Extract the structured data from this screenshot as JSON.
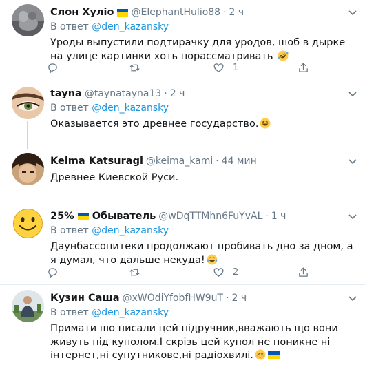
{
  "tweets": [
    {
      "name": "Слон Хуліо",
      "handle": "@ElephantHulio88",
      "time": "2 ч",
      "reply_prefix": "В ответ",
      "reply_to": "@den_kazansky",
      "text": "Уроды выпустили подтирачку для уродов, шоб в дырке на улице картинки хоть порассматривать",
      "emoji": "rolling-laughing-emoji",
      "likes": "1"
    },
    {
      "name": "tayna",
      "handle": "@taynatayna13",
      "time": "2 ч",
      "reply_prefix": "В ответ",
      "reply_to": "@den_kazansky",
      "text": "Оказывается это древнее государство.",
      "emoji": "grinning-squint-emoji"
    },
    {
      "name": "Keima Katsuragi",
      "handle": "@keima_kami",
      "time": "44 мин",
      "text": "Древнее Киевской Руси."
    },
    {
      "name_prefix": "25%",
      "name": "Обыватель",
      "handle": "@wDqTTMhn6FuYvAL",
      "time": "1 ч",
      "reply_prefix": "В ответ",
      "reply_to": "@den_kazansky",
      "text": "Даунбассопитеки продолжают пробивать дно за дном, а я думал, что дальше некуда!",
      "emoji": "tears-of-joy-emoji",
      "likes": "2"
    },
    {
      "name": "Кузин Саша",
      "handle": "@xWOdiYfobfHW9uT",
      "time": "2 ч",
      "reply_prefix": "В ответ",
      "reply_to": "@den_kazansky",
      "text": "Примати шо писали цей підручник,вважають що вони живуть під куполом.І скрізь цей купол не поникне ні інтернет,ні супутникове,ні радіохвилі.",
      "emoji": "relieved-emoji"
    }
  ],
  "colors": {
    "accent": "#1b95e0",
    "muted": "#657786",
    "border": "#e6ecf0",
    "flag_blue": "#0057b7",
    "flag_yellow": "#ffd700"
  }
}
